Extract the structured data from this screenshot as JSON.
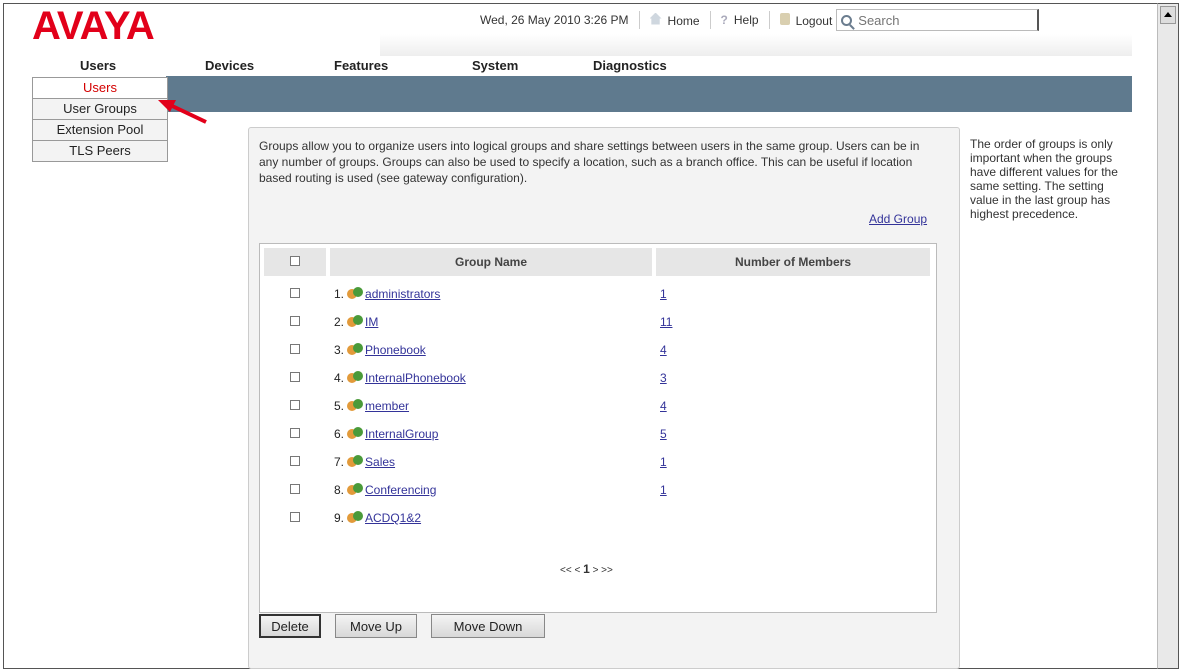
{
  "header": {
    "logo": "AVAYA",
    "datetime": "Wed, 26 May 2010 3:26 PM",
    "home": "Home",
    "help": "Help",
    "logout": "Logout",
    "search_placeholder": "Search"
  },
  "mainnav": [
    "Users",
    "Devices",
    "Features",
    "System",
    "Diagnostics"
  ],
  "submenu": [
    "Users",
    "User Groups",
    "Extension Pool",
    "TLS Peers"
  ],
  "intro": "Groups allow you to organize users into logical groups and share settings between users in the same group. Users can be in any number of groups. Groups can also be used to specify a location, such as a branch office. This can be useful if location based routing is used (see gateway configuration).",
  "add_group": "Add Group",
  "table": {
    "col_name": "Group Name",
    "col_members": "Number of Members",
    "rows": [
      {
        "num": "1.",
        "name": "administrators",
        "members": "1"
      },
      {
        "num": "2.",
        "name": "IM",
        "members": "11"
      },
      {
        "num": "3.",
        "name": "Phonebook",
        "members": "4"
      },
      {
        "num": "4.",
        "name": "InternalPhonebook",
        "members": "3"
      },
      {
        "num": "5.",
        "name": "member",
        "members": "4"
      },
      {
        "num": "6.",
        "name": "InternalGroup",
        "members": "5"
      },
      {
        "num": "7.",
        "name": "Sales",
        "members": "1"
      },
      {
        "num": "8.",
        "name": "Conferencing",
        "members": "1"
      },
      {
        "num": "9.",
        "name": "ACDQ1&2",
        "members": ""
      }
    ]
  },
  "pager": {
    "prev": "<< <",
    "current": "1",
    "next": "> >>"
  },
  "buttons": {
    "delete": "Delete",
    "move_up": "Move Up",
    "move_down": "Move Down"
  },
  "side_note": "The order of groups is only important when the groups have different values for the same setting. The setting value in the last group has highest precedence.",
  "colors": {
    "brand": "#e2001a",
    "navbar": "#5f7a8e",
    "link": "#333399",
    "active_menu": "#d40000"
  }
}
